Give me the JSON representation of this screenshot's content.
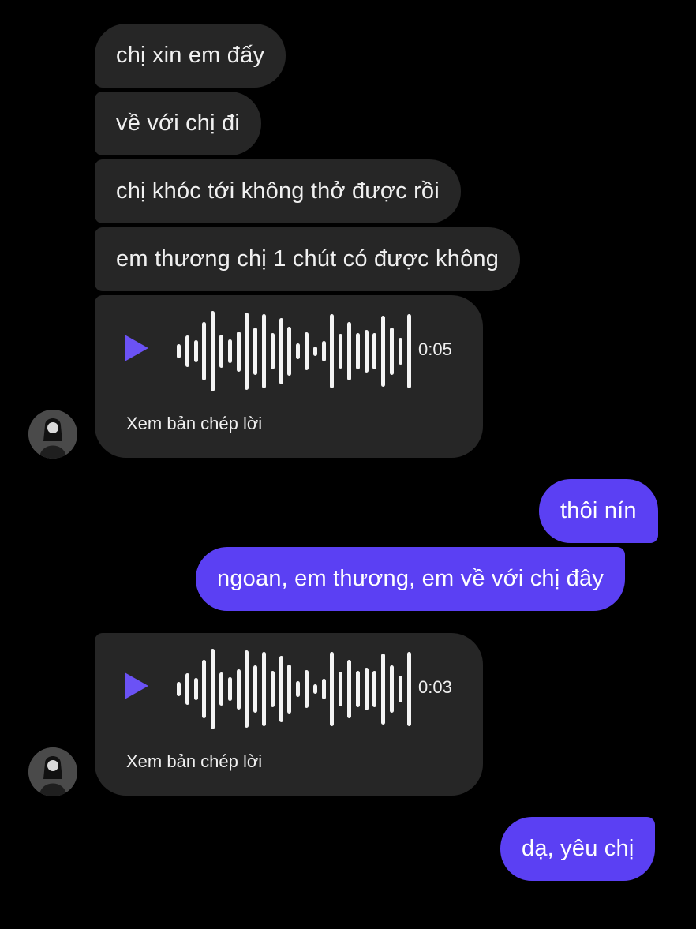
{
  "messages": {
    "incoming_1": "chị xin em đấy",
    "incoming_2": "về với chị đi",
    "incoming_3": "chị khóc tới không thở được rồi",
    "incoming_4": "em thương chị 1 chút có được không",
    "voice_1": {
      "duration": "0:05",
      "transcript_label": "Xem bản chép lời"
    },
    "outgoing_1": "thôi nín",
    "outgoing_2": "ngoan, em thương, em về với chị đây",
    "voice_2": {
      "duration": "0:03",
      "transcript_label": "Xem bản chép lời"
    },
    "outgoing_3": "dạ, yêu chị"
  },
  "waveform_levels": [
    0.18,
    0.4,
    0.28,
    0.72,
    1.0,
    0.42,
    0.3,
    0.5,
    0.96,
    0.58,
    0.92,
    0.46,
    0.82,
    0.6,
    0.2,
    0.48,
    0.12,
    0.25,
    0.92,
    0.44,
    0.72,
    0.46,
    0.52,
    0.45,
    0.88,
    0.58,
    0.34,
    0.92
  ],
  "colors": {
    "background": "#000000",
    "incoming_bubble": "#262626",
    "outgoing_bubble": "#5b40f3",
    "play_icon": "#6b52f5"
  }
}
